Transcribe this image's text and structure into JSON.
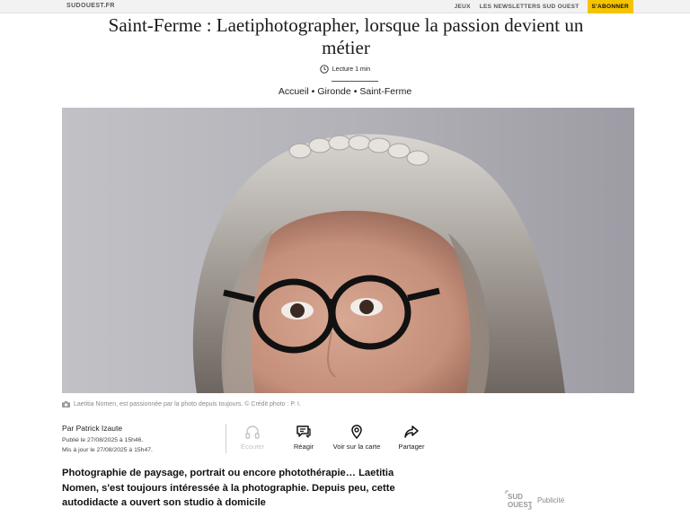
{
  "topbar": {
    "brand": "SUDOUEST.FR",
    "links": [
      "JEUX",
      "LES NEWSLETTERS SUD OUEST"
    ],
    "subscribe_label": "S'ABONNER"
  },
  "article": {
    "title": "Saint-Ferme : Laetiphotographer, lorsque la passion devient un métier",
    "read_time": "Lecture 1 min",
    "breadcrumb": [
      "Accueil",
      "Gironde",
      "Saint-Ferme"
    ],
    "breadcrumb_sep": "•",
    "photo_caption": "Laetitia Nomen, est passionnée par la photo depuis toujours. © Crédit photo : P. I.",
    "author": "Par Patrick Izaute",
    "published": "Publié le 27/08/2025 à 15h46.",
    "updated": "Mis à jour le 27/08/2025 à 15h47.",
    "lead": "Photographie de paysage, portrait ou encore photothérapie… Laetitia Nomen, s'est toujours intéressée à la photographie. Depuis peu, cette autodidacte a ouvert son studio à domicile"
  },
  "actions": {
    "listen": "Écouter",
    "react": "Réagir",
    "map": "Voir sur la carte",
    "share": "Partager"
  },
  "ad": {
    "logo_text": [
      "SUD",
      "OUEST"
    ],
    "label": "Publicité"
  },
  "colors": {
    "subscribe_bg": "#f5c400",
    "topbar_bg": "#f2f2f2",
    "disabled_text": "#c4c4c4"
  }
}
